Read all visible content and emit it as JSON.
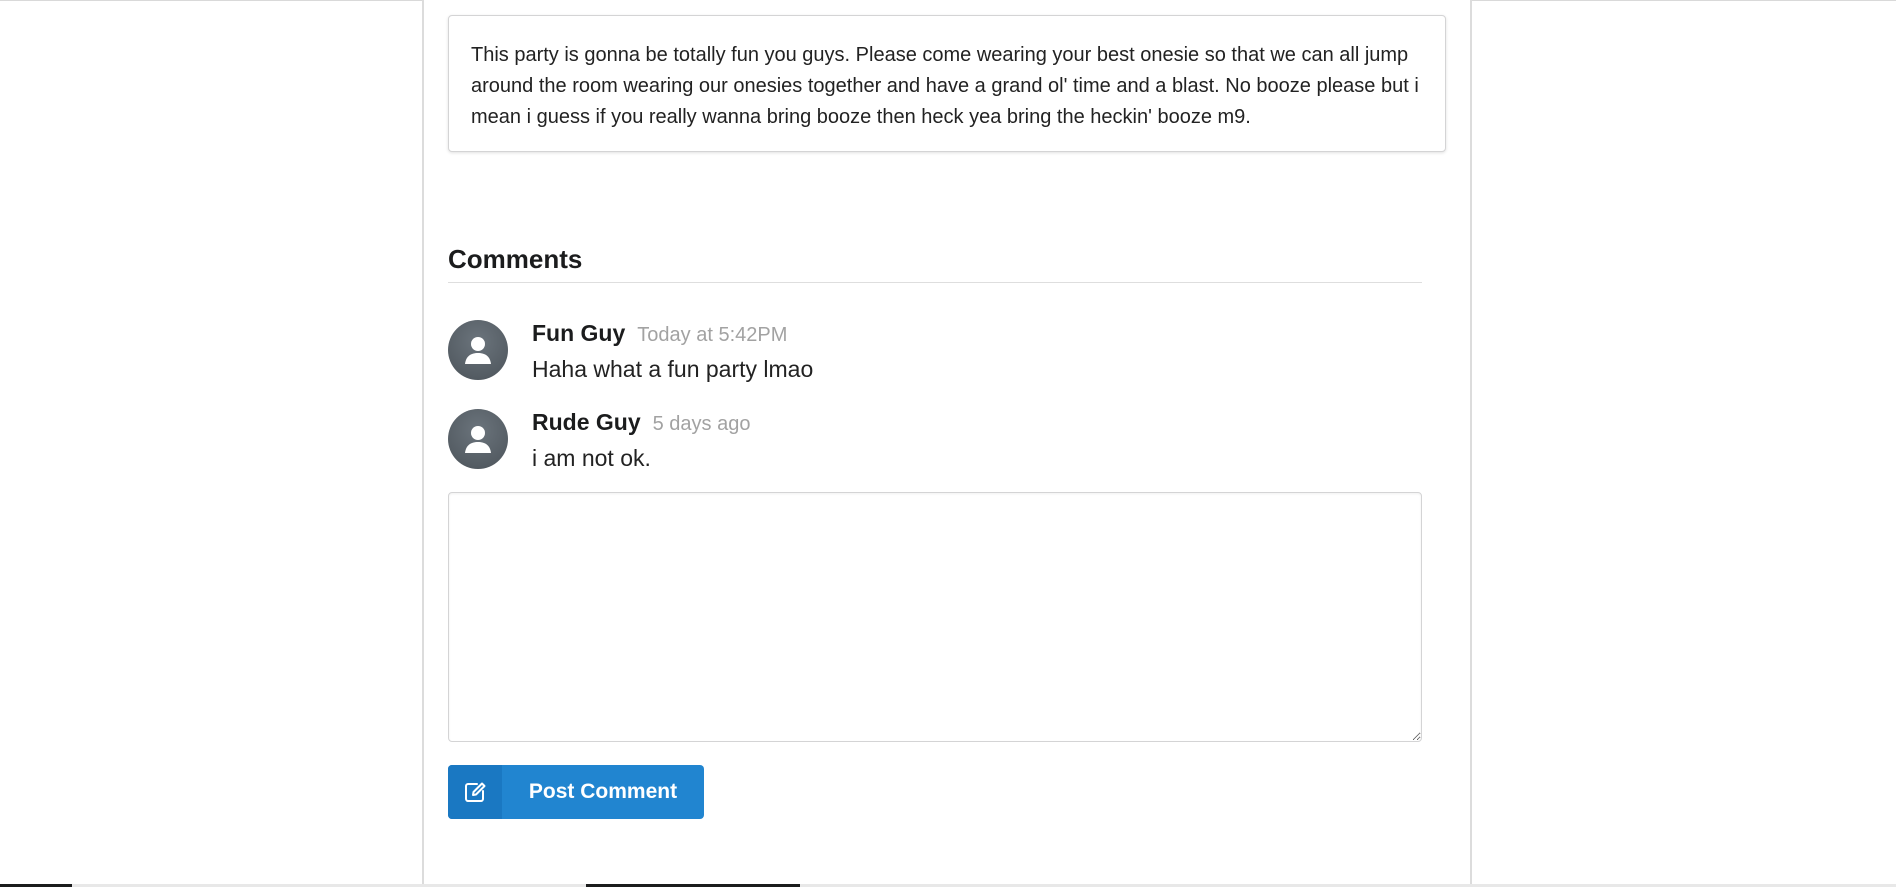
{
  "event": {
    "description": "This party is gonna be totally fun you guys. Please come wearing your best onesie so that we can all jump around the room wearing our onesies together and have a grand ol' time and a blast. No booze please but i mean i guess if you really wanna bring booze then heck yea bring the heckin' booze m9."
  },
  "comments_section": {
    "title": "Comments",
    "comments": [
      {
        "author": "Fun Guy",
        "date": "Today at 5:42PM",
        "text": "Haha what a fun party lmao",
        "avatar_icon": "user-icon"
      },
      {
        "author": "Rude Guy",
        "date": "5 days ago",
        "text": "i am not ok.",
        "avatar_icon": "user-icon"
      }
    ],
    "reply": {
      "value": "",
      "button_label": "Post Comment",
      "button_icon": "edit-icon"
    }
  },
  "colors": {
    "primary_button": "#2185d0",
    "muted_date_text": "#a2a2a2",
    "avatar_background": "#5d656c"
  }
}
